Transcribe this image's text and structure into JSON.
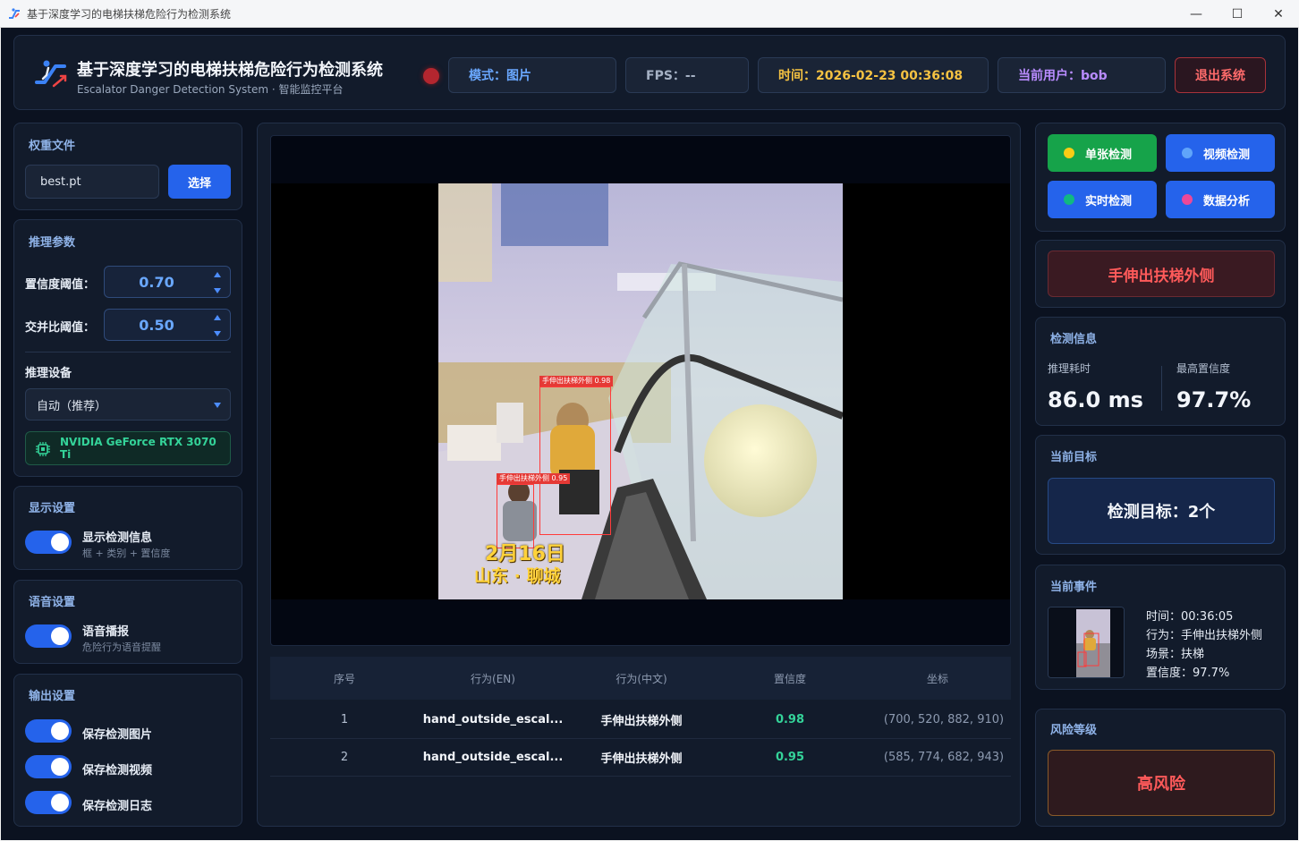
{
  "window": {
    "title": "基于深度学习的电梯扶梯危险行为检测系统",
    "minimize": "—",
    "maximize": "☐",
    "close": "✕"
  },
  "header": {
    "title": "基于深度学习的电梯扶梯危险行为检测系统",
    "subtitle": "Escalator Danger Detection System · 智能监控平台",
    "mode": "模式：图片",
    "fps": "FPS：--",
    "time": "时间：2026-02-23 00:36:08",
    "user": "当前用户：bob",
    "logout_label": "退出系统",
    "status_color": "#b3262f"
  },
  "weights": {
    "title": "权重文件",
    "value": "best.pt",
    "select_label": "选择"
  },
  "params": {
    "title": "推理参数",
    "conf_label": "置信度阈值：",
    "conf_value": "0.70",
    "iou_label": "交并比阈值：",
    "iou_value": "0.50",
    "device_title": "推理设备",
    "device_value": "自动（推荐）",
    "gpu": "NVIDIA GeForce RTX 3070 Ti"
  },
  "display": {
    "title": "显示设置",
    "toggle_label": "显示检测信息",
    "toggle_sub": "框 + 类别 + 置信度",
    "on": true
  },
  "voice": {
    "title": "语音设置",
    "toggle_label": "语音播报",
    "toggle_sub": "危险行为语音提醒",
    "on": true
  },
  "output": {
    "title": "输出设置",
    "items": [
      {
        "label": "保存检测图片",
        "on": true
      },
      {
        "label": "保存检测视频",
        "on": true
      },
      {
        "label": "保存检测日志",
        "on": true
      }
    ]
  },
  "viewer": {
    "detections": [
      {
        "label": "手伸出扶梯外侧 0.98"
      },
      {
        "label": "手伸出扶梯外侧 0.95"
      }
    ],
    "caption_date": "2月16日",
    "caption_place": "山东 · 聊城"
  },
  "table": {
    "headers": [
      "序号",
      "行为(EN)",
      "行为(中文)",
      "置信度",
      "坐标"
    ],
    "rows": [
      [
        "1",
        "hand_outside_escal...",
        "手伸出扶梯外侧",
        "0.98",
        "(700, 520, 882, 910)"
      ],
      [
        "2",
        "hand_outside_escal...",
        "手伸出扶梯外侧",
        "0.95",
        "(585, 774, 682, 943)"
      ]
    ]
  },
  "modes": {
    "single": "单张检测",
    "video": "视频检测",
    "realtime": "实时检测",
    "analysis": "数据分析",
    "colors": {
      "single_bg": "#16a34a",
      "blue_bg": "#2563eb",
      "single_dot": "#facc15",
      "video_dot": "#60a5fa",
      "realtime_dot": "#10b981",
      "analysis_dot": "#ec4899"
    }
  },
  "alert": {
    "text": "手伸出扶梯外侧"
  },
  "info": {
    "title": "检测信息",
    "infer_label": "推理耗时",
    "infer_value": "86.0 ms",
    "conf_label": "最高置信度",
    "conf_value": "97.7%"
  },
  "target": {
    "title": "当前目标",
    "text": "检测目标：2个"
  },
  "event": {
    "title": "当前事件",
    "time": "时间：00:36:05",
    "behavior": "行为：手伸出扶梯外侧",
    "scene": "场景：扶梯",
    "confidence": "置信度：97.7%"
  },
  "risk": {
    "title": "风险等级",
    "text": "高风险"
  }
}
